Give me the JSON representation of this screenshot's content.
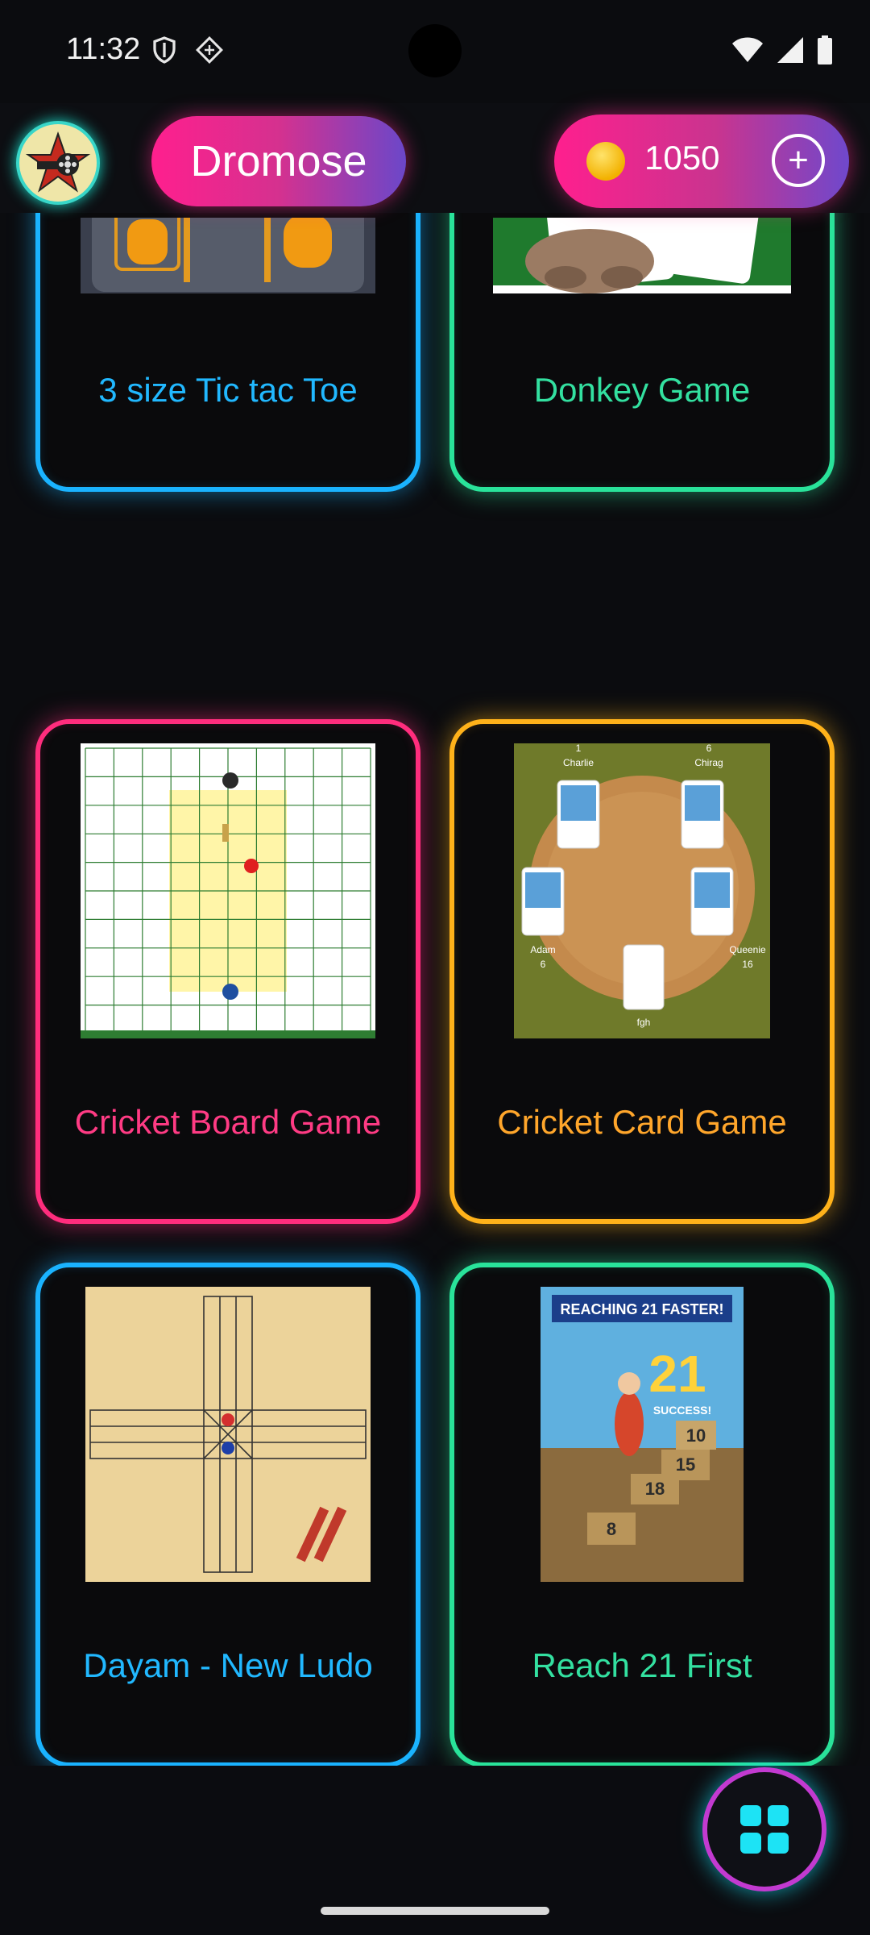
{
  "status_bar": {
    "time": "11:32",
    "icons": [
      "shield-icon",
      "data-saver-icon",
      "wifi-icon",
      "signal-icon",
      "battery-icon"
    ]
  },
  "header": {
    "avatar_icon": "film-reel-star-icon",
    "app_title": "Dromose",
    "coins": "1050",
    "coin_icon": "coin-icon",
    "add_coins_icon": "plus-icon",
    "add_coins_label": "+"
  },
  "games": [
    {
      "title": "3 size Tic tac Toe",
      "color": "#1ab3ff",
      "label_color": "#21b8ff"
    },
    {
      "title": "Donkey Game",
      "color": "#29e39a",
      "label_color": "#33e0a0"
    },
    {
      "title": "Cricket Board Game",
      "color": "#ff2d7d",
      "label_color": "#ff3b84"
    },
    {
      "title": "Cricket Card Game",
      "color": "#ffb21a",
      "label_color": "#ffa62b"
    },
    {
      "title": "Dayam - New Ludo",
      "color": "#1ab3ff",
      "label_color": "#21b8ff"
    },
    {
      "title": "Reach 21 First",
      "color": "#29e39a",
      "label_color": "#33e0a0"
    }
  ],
  "thumb_text": {
    "cricket_card_names": [
      "Charlie",
      "Chirag",
      "Adam",
      "Queenie",
      "fgh"
    ],
    "cricket_card_scores": [
      "1",
      "6",
      "6",
      "16"
    ],
    "reach21_banner": "REACHING 21 FASTER!",
    "reach21_big": "21",
    "reach21_success": "SUCCESS!",
    "reach21_steps": [
      "10",
      "15",
      "18",
      "8"
    ]
  },
  "fab": {
    "icon": "grid-icon"
  }
}
